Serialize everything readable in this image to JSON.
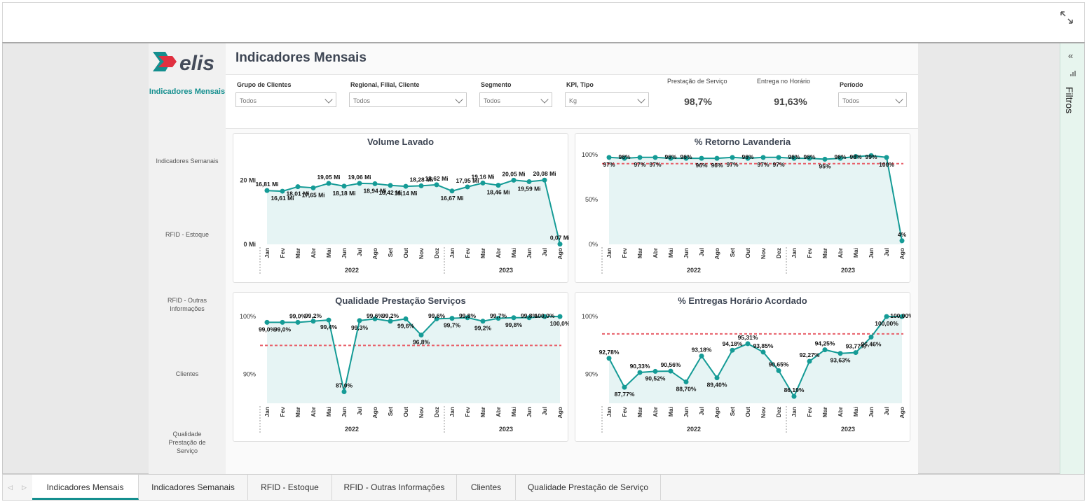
{
  "window": {
    "expand_icon": "expand-icon"
  },
  "nav": {
    "logo_text": "elis",
    "items": [
      {
        "label": "Indicadores Mensais",
        "active": true
      },
      {
        "label": "Indicadores Semanais",
        "active": false
      },
      {
        "label": "RFID - Estoque",
        "active": false
      },
      {
        "label": "RFID - Outras Informações",
        "active": false
      },
      {
        "label": "Clientes",
        "active": false
      },
      {
        "label": "Qualidade Prestação de Serviço",
        "active": false
      }
    ]
  },
  "page_title": "Indicadores Mensais",
  "filters": {
    "grupo": {
      "label": "Grupo de Clientes",
      "value": "Todos"
    },
    "regional": {
      "label": "Regional, Filial, Cliente",
      "value": "Todos"
    },
    "segmento": {
      "label": "Segmento",
      "value": "Todos"
    },
    "kpi": {
      "label": "KPI, Tipo",
      "value": "Kg"
    },
    "periodo": {
      "label": "Período",
      "value": "Todos"
    }
  },
  "kpis": {
    "prestacao": {
      "label": "Prestação de Serviço",
      "value": "98,7%"
    },
    "entrega": {
      "label": "Entrega no Horário",
      "value": "91,63%"
    }
  },
  "filtros_panel": {
    "label": "Filtros",
    "collapse": "«"
  },
  "tabs": [
    {
      "label": "Indicadores Mensais",
      "active": true
    },
    {
      "label": "Indicadores Semanais",
      "active": false
    },
    {
      "label": "RFID - Estoque",
      "active": false
    },
    {
      "label": "RFID - Outras Informações",
      "active": false
    },
    {
      "label": "Clientes",
      "active": false
    },
    {
      "label": "Qualidade Prestação de Serviço",
      "active": false
    }
  ],
  "colors": {
    "accent": "#148f8f",
    "line": "#159b96",
    "area": "#e6f4f4",
    "target": "#e8606a"
  },
  "chart_data": [
    {
      "type": "area",
      "title": "Volume Lavado",
      "months": [
        "Jan",
        "Fev",
        "Mar",
        "Abr",
        "Mai",
        "Jun",
        "Jul",
        "Ago",
        "Set",
        "Out",
        "Nov",
        "Dez",
        "Jan",
        "Fev",
        "Mar",
        "Abr",
        "Mai",
        "Jun",
        "Jul",
        "Ago"
      ],
      "years": [
        "2022",
        "2023"
      ],
      "yticks": [
        "20 Mi",
        "0 Mi"
      ],
      "ylim": [
        0,
        28
      ],
      "values": [
        16.81,
        16.61,
        18.01,
        17.65,
        19.05,
        18.18,
        19.06,
        18.94,
        18.42,
        18.14,
        18.28,
        18.62,
        16.67,
        17.95,
        19.16,
        18.46,
        20.05,
        19.59,
        20.08,
        0.07
      ],
      "labels": [
        "16,81 Mi",
        "16,61 Mi",
        "18,01 Mi",
        "17,65 Mi",
        "19,05 Mi",
        "18,18 Mi",
        "19,06 Mi",
        "18,94 Mi",
        "18,42 Mi",
        "18,14 Mi",
        "18,28 Mi",
        "18,62 Mi",
        "16,67 Mi",
        "17,95 Mi",
        "19,16 Mi",
        "18,46 Mi",
        "20,05 Mi",
        "19,59 Mi",
        "20,08 Mi",
        "0,07 Mi"
      ],
      "label_pos": [
        "a",
        "b",
        "b",
        "b",
        "a",
        "b",
        "a",
        "b",
        "b",
        "b",
        "a",
        "a",
        "b",
        "a",
        "a",
        "b",
        "a",
        "b",
        "a",
        "a"
      ],
      "target": null
    },
    {
      "type": "area",
      "title": "% Retorno Lavanderia",
      "months": [
        "Jan",
        "Fev",
        "Mar",
        "Abr",
        "Mai",
        "Jun",
        "Jul",
        "Ago",
        "Set",
        "Out",
        "Nov",
        "Dez",
        "Jan",
        "Fev",
        "Mar",
        "Abr",
        "Mai",
        "Jun",
        "Jul",
        "Ago"
      ],
      "years": [
        "2022",
        "2023"
      ],
      "yticks": [
        "100%",
        "50%",
        "0%"
      ],
      "ylim": [
        0,
        100
      ],
      "values": [
        97,
        96,
        97,
        97,
        96,
        96,
        96,
        96,
        97,
        96,
        97,
        97,
        96,
        96,
        95,
        96,
        98,
        99,
        97,
        4
      ],
      "labels": [
        "97%",
        "96%",
        "97%",
        "97%",
        "96%",
        "96%",
        "96%",
        "96%",
        "97%",
        "96%",
        "97%",
        "97%",
        "96%",
        "96%",
        "95%",
        "96%",
        "98%",
        "99%",
        "100%",
        "4%"
      ],
      "label_pos": [
        "b",
        "a",
        "b",
        "b",
        "a",
        "a",
        "b",
        "b",
        "b",
        "a",
        "b",
        "b",
        "a",
        "a",
        "b",
        "a",
        "a",
        "a",
        "b",
        "a"
      ],
      "target": 90
    },
    {
      "type": "line",
      "title": "Qualidade Prestação Serviços",
      "months": [
        "Jan",
        "Fev",
        "Mar",
        "Abr",
        "Mai",
        "Jun",
        "Jul",
        "Ago",
        "Set",
        "Out",
        "Nov",
        "Dez",
        "Jan",
        "Fev",
        "Mar",
        "Abr",
        "Mai",
        "Jun",
        "Jul",
        "Ago"
      ],
      "years": [
        "2022",
        "2023"
      ],
      "yticks": [
        "100%",
        "90%"
      ],
      "ylim": [
        85,
        100.5
      ],
      "values": [
        99.0,
        99.0,
        99.0,
        99.2,
        99.4,
        87.0,
        99.3,
        99.6,
        99.2,
        99.6,
        96.8,
        99.6,
        99.7,
        99.8,
        99.2,
        99.7,
        99.8,
        99.8,
        100.0,
        100.0
      ],
      "labels": [
        "99,0%",
        "99,0%",
        "99,0%",
        "99,2%",
        "99,4%",
        "87,0%",
        "99,3%",
        "99,6%",
        "99,2%",
        "99,6%",
        "96,8%",
        "99,6%",
        "99,7%",
        "99,8%",
        "99,2%",
        "99,7%",
        "99,8%",
        "99,8%",
        "100,0%",
        "100,0%"
      ],
      "label_pos": [
        "b",
        "b",
        "a",
        "a",
        "b",
        "a",
        "b",
        "a",
        "a",
        "b",
        "b",
        "a",
        "b",
        "a",
        "b",
        "a",
        "b",
        "a",
        "a",
        "b"
      ],
      "target": 95
    },
    {
      "type": "line",
      "title": "% Entregas Horário Acordado",
      "months": [
        "Jan",
        "Fev",
        "Mar",
        "Abr",
        "Mai",
        "Jun",
        "Jul",
        "Ago",
        "Set",
        "Out",
        "Nov",
        "Dez",
        "Jan",
        "Fev",
        "Mar",
        "Abr",
        "Mai",
        "Jun",
        "Jul",
        "Ago"
      ],
      "years": [
        "2022",
        "2023"
      ],
      "yticks": [
        "100%",
        "90%"
      ],
      "ylim": [
        85,
        100.5
      ],
      "values": [
        92.78,
        87.77,
        90.33,
        90.52,
        90.56,
        88.7,
        93.18,
        89.4,
        94.18,
        95.31,
        93.85,
        90.65,
        86.19,
        92.27,
        94.25,
        93.63,
        93.77,
        96.46,
        100.0,
        100.0
      ],
      "labels": [
        "92,78%",
        "87,77%",
        "90,33%",
        "90,52%",
        "90,56%",
        "88,70%",
        "93,18%",
        "89,40%",
        "94,18%",
        "95,31%",
        "93,85%",
        "90,65%",
        "86,19%",
        "92,27%",
        "94,25%",
        "93,63%",
        "93,77%",
        "96,46%",
        "100,00%",
        "100,00%"
      ],
      "label_pos": [
        "a",
        "b",
        "a",
        "b",
        "a",
        "b",
        "a",
        "b",
        "a",
        "a",
        "a",
        "a",
        "a",
        "a",
        "a",
        "b",
        "a",
        "b",
        "b",
        "a"
      ],
      "target": 97
    }
  ]
}
